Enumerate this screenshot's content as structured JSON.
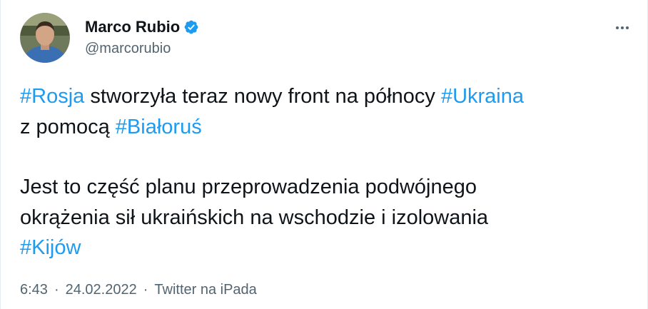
{
  "author": {
    "name": "Marco Rubio",
    "handle": "@marcorubio",
    "verified": true,
    "avatar_icon": "user-avatar-photo"
  },
  "tweet": {
    "paragraph1": {
      "line1": {
        "hashtag1": "#Rosja",
        "text1": " stworzyła teraz nowy front na północy ",
        "hashtag2": "#Ukraina"
      },
      "line2": {
        "text1": "z pomocą ",
        "hashtag1": "#Białoruś"
      }
    },
    "paragraph2": {
      "line1": "Jest to część planu przeprowadzenia podwójnego",
      "line2": "okrążenia sił ukraińskich na wschodzie i izolowania",
      "hashtag": "#Kijów"
    }
  },
  "meta": {
    "time": "6:43",
    "dot1": "·",
    "date": "24.02.2022",
    "dot2": "·",
    "source": "Twitter na iPada"
  },
  "colors": {
    "link": "#1d9bf0",
    "text": "#0f1419",
    "secondary": "#536471"
  },
  "icons": {
    "verified": "verified-badge-icon",
    "more": "more-dots-icon"
  }
}
